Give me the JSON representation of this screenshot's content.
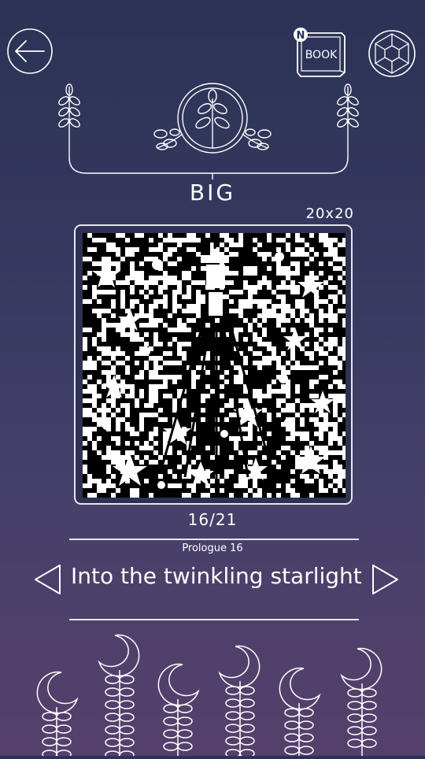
{
  "header": {
    "back_icon": "back-arrow-icon",
    "book_label": "BOOK",
    "book_badge": "N",
    "settings_icon": "settings-hexagon-icon"
  },
  "puzzle": {
    "difficulty": "BIG",
    "grid_size": "20x20",
    "progress": "16/21",
    "chapter": "Prologue 16",
    "title": "Into the twinkling starlight"
  },
  "colors": {
    "ink": "#ffffff",
    "background_top": "#2c3256",
    "background_bottom": "#55406b",
    "pixel_dark": "#000000"
  }
}
